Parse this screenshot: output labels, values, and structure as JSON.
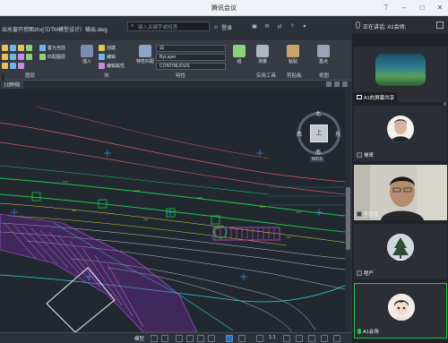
{
  "window": {
    "title": "腾讯会议"
  },
  "cad": {
    "file_title": "出水窗开挖图zhx[（DTM模型设计）输出.dwg",
    "search_placeholder": "键入关键字或短语",
    "login": "登录",
    "ribbon": {
      "groups": [
        "图层",
        "块",
        "特性",
        "实用工具",
        "剪贴板",
        "视图"
      ],
      "tools": {
        "create": "创建",
        "edit": "编辑",
        "edit_attr": "编辑属性",
        "set_current": "置为当前",
        "match_layer": "匹配图层",
        "insert": "插入",
        "match_props": "特性匹配",
        "measure": "测量",
        "paste": "粘贴",
        "base": "基点",
        "group": "组"
      },
      "color_value": "白",
      "linetype_value": "ByLayer",
      "lineweight_value": "CONTINUOUS"
    },
    "doc_tab": "[-][俯视]",
    "viewcube": {
      "top": "上",
      "north": "北",
      "south": "南",
      "west": "西",
      "east": "东",
      "wcs": "WCS"
    },
    "statusbar": {
      "model": "模型",
      "scale": "1:1"
    }
  },
  "meeting": {
    "talking_label": "正在讲话: A1会场;",
    "participants": [
      {
        "name": "A1的屏幕共享",
        "kind": "screen-share"
      },
      {
        "name": "禅哥",
        "kind": "avatar"
      },
      {
        "name": "李国道",
        "kind": "video"
      },
      {
        "name": "程严",
        "kind": "avatar"
      },
      {
        "name": "A1会场",
        "kind": "avatar"
      }
    ]
  },
  "colors": {
    "cad_bg": "#212830",
    "ribbon_bg": "#353a43",
    "panel_bg": "#202329",
    "accent_green": "#20c44a"
  }
}
